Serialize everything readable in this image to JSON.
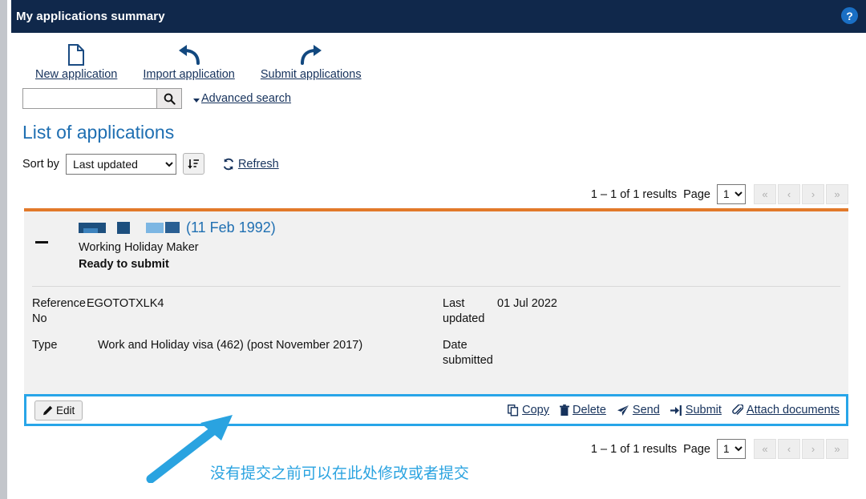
{
  "header": {
    "title": "My applications summary",
    "help_icon": "question-mark-circle-icon",
    "help_glyph": "?",
    "bg_color": "#10284b"
  },
  "toolbar": {
    "items": [
      {
        "label": "New application",
        "icon": "document-page-icon"
      },
      {
        "label": "Import application",
        "icon": "curved-arrow-left-icon"
      },
      {
        "label": "Submit applications",
        "icon": "curved-arrow-right-icon"
      }
    ]
  },
  "search": {
    "value": "",
    "placeholder": "",
    "button_icon": "search-magnifier-icon",
    "advanced_label": "Advanced search",
    "advanced_caret": "caret-down-icon"
  },
  "list": {
    "heading": "List of applications",
    "sort_label": "Sort by",
    "sort_value": "Last updated",
    "sort_options": [
      "Last updated"
    ],
    "sort_direction_icon": "sort-descending-icon",
    "refresh_label": "Refresh",
    "refresh_icon": "refresh-circular-arrows-icon"
  },
  "pagination_top": {
    "results": "1 – 1 of 1 results",
    "page_word": "Page",
    "page_value": "1",
    "page_options": [
      "1"
    ],
    "buttons": [
      {
        "glyph": "«",
        "name": "first-page-button"
      },
      {
        "glyph": "‹",
        "name": "previous-page-button"
      },
      {
        "glyph": "›",
        "name": "next-page-button"
      },
      {
        "glyph": "»",
        "name": "last-page-button"
      }
    ]
  },
  "pagination_bottom": {
    "results": "1 – 1 of 1 results",
    "page_word": "Page",
    "page_value": "1",
    "page_options": [
      "1"
    ],
    "buttons": [
      {
        "glyph": "«",
        "name": "first-page-button"
      },
      {
        "glyph": "‹",
        "name": "previous-page-button"
      },
      {
        "glyph": "›",
        "name": "next-page-button"
      },
      {
        "glyph": "»",
        "name": "last-page-button"
      }
    ]
  },
  "application": {
    "collapse_icon": "minus-collapse-icon",
    "applicant_name_redacted": true,
    "date_of_birth": "(11 Feb 1992)",
    "visa_class": "Working Holiday Maker",
    "status": "Ready to submit",
    "accent_color": "#e2792a",
    "fields_left": [
      {
        "label_line1": "Reference",
        "label_line2": "No",
        "value": "EGOTOTXLK4"
      },
      {
        "label_line1": "Type",
        "label_line2": "",
        "value": "Work and Holiday visa (462) (post November 2017)"
      }
    ],
    "fields_right": [
      {
        "label_line1": "Last",
        "label_line2": "updated",
        "value": "01 Jul 2022"
      },
      {
        "label_line1": "Date",
        "label_line2": "submitted",
        "value": ""
      }
    ]
  },
  "actions": {
    "edit_label": "Edit",
    "edit_icon": "pencil-icon",
    "links": [
      {
        "label": "Copy",
        "icon": "copy-pages-icon"
      },
      {
        "label": "Delete",
        "icon": "trash-bin-icon"
      },
      {
        "label": "Send",
        "icon": "paper-plane-icon"
      },
      {
        "label": "Submit",
        "icon": "arrow-into-bracket-icon"
      },
      {
        "label": "Attach documents",
        "icon": "paperclip-icon"
      }
    ],
    "highlight_color": "#28a5e8"
  },
  "annotation": {
    "text": "没有提交之前可以在此处修改或者提交",
    "color": "#2aa3e0",
    "arrow_icon": "annotation-arrow-up-right-icon"
  }
}
